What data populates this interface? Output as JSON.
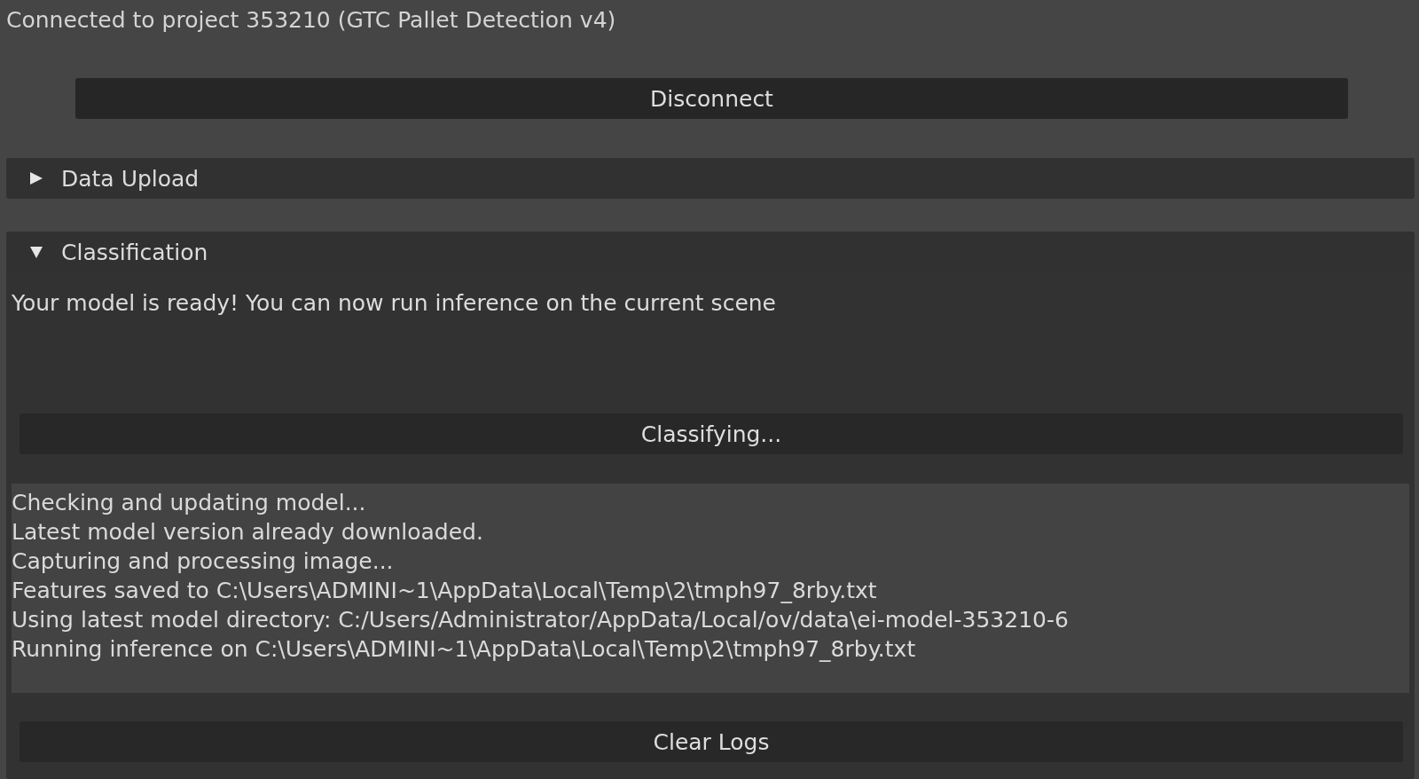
{
  "status": "Connected to project 353210 (GTC Pallet Detection v4)",
  "disconnect_button": "Disconnect",
  "sections": [
    {
      "title": "Data Upload",
      "expanded": false
    },
    {
      "title": "Classification",
      "expanded": true,
      "message": "Your model is ready! You can now run inference on the current scene",
      "action_button": "Classifying...",
      "log": [
        "Checking and updating model...",
        "Latest model version already downloaded.",
        "Capturing and processing image...",
        "Features saved to C:\\Users\\ADMINI~1\\AppData\\Local\\Temp\\2\\tmph97_8rby.txt",
        "Using latest model directory: C:/Users/Administrator/AppData/Local/ov/data\\ei-model-353210-6",
        "Running inference on C:\\Users\\ADMINI~1\\AppData\\Local\\Temp\\2\\tmph97_8rby.txt"
      ],
      "clear_button": "Clear Logs"
    }
  ]
}
